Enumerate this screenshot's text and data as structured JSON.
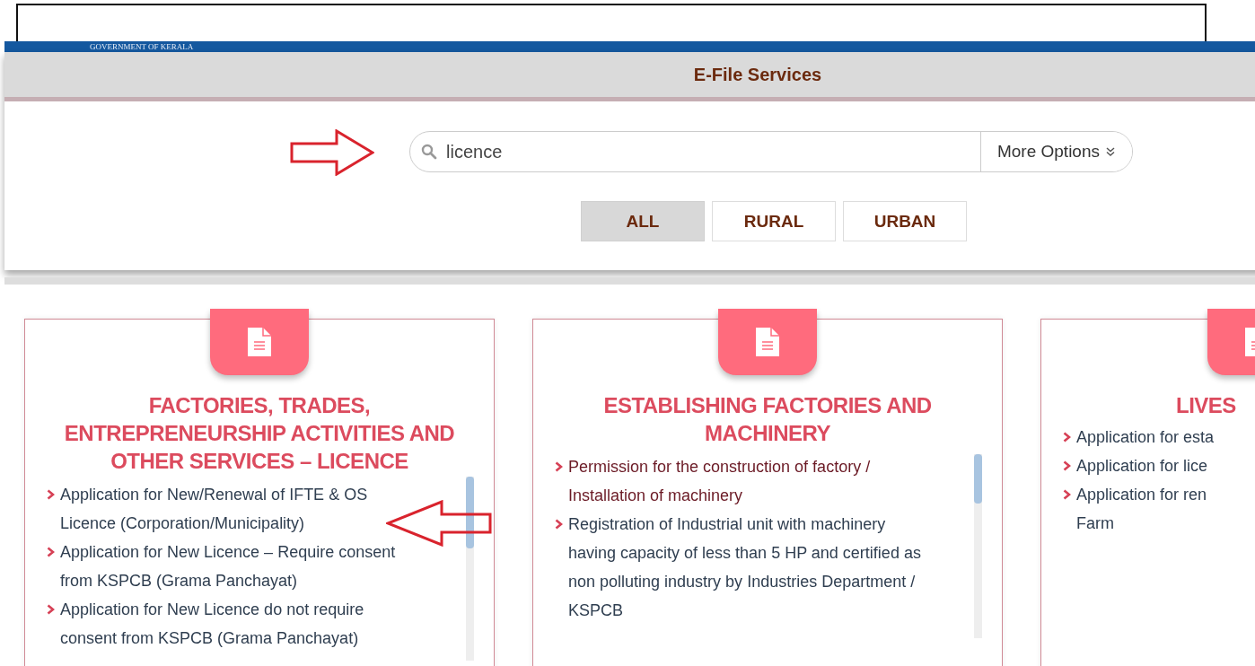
{
  "banner": {
    "subtitle": "GOVERNMENT OF KERALA"
  },
  "header": {
    "title": "E-File Services"
  },
  "search": {
    "value": "licence",
    "more_options": "More Options"
  },
  "filters": [
    {
      "label": "ALL",
      "selected": true
    },
    {
      "label": "RURAL",
      "selected": false
    },
    {
      "label": "URBAN",
      "selected": false
    }
  ],
  "cards": [
    {
      "title": [
        "FACTORIES, TRADES,",
        "ENTREPRENEURSHIP ACTIVITIES AND",
        "OTHER SERVICES – LICENCE"
      ],
      "items": [
        {
          "lines": [
            "Application for New/Renewal of IFTE & OS",
            "Licence (Corporation/Municipality)"
          ]
        },
        {
          "lines": [
            "Application for New Licence – Require consent",
            "from KSPCB (Grama Panchayat)"
          ]
        },
        {
          "lines": [
            "Application for New Licence do not require",
            "consent from KSPCB (Grama Panchayat)"
          ]
        }
      ]
    },
    {
      "title": [
        "ESTABLISHING FACTORIES AND",
        "MACHINERY"
      ],
      "items": [
        {
          "lines": [
            "Permission for the construction of factory /",
            "Installation of machinery"
          ]
        },
        {
          "lines": [
            "Registration of Industrial unit with machinery",
            "having capacity of less than 5 HP and certified as",
            "non polluting industry by Industries Department /",
            "KSPCB"
          ]
        }
      ]
    },
    {
      "title": [
        "LIVES"
      ],
      "items": [
        {
          "lines": [
            "Application for esta"
          ]
        },
        {
          "lines": [
            "Application for lice"
          ]
        },
        {
          "lines": [
            "Application for ren",
            "Farm"
          ]
        }
      ]
    }
  ]
}
